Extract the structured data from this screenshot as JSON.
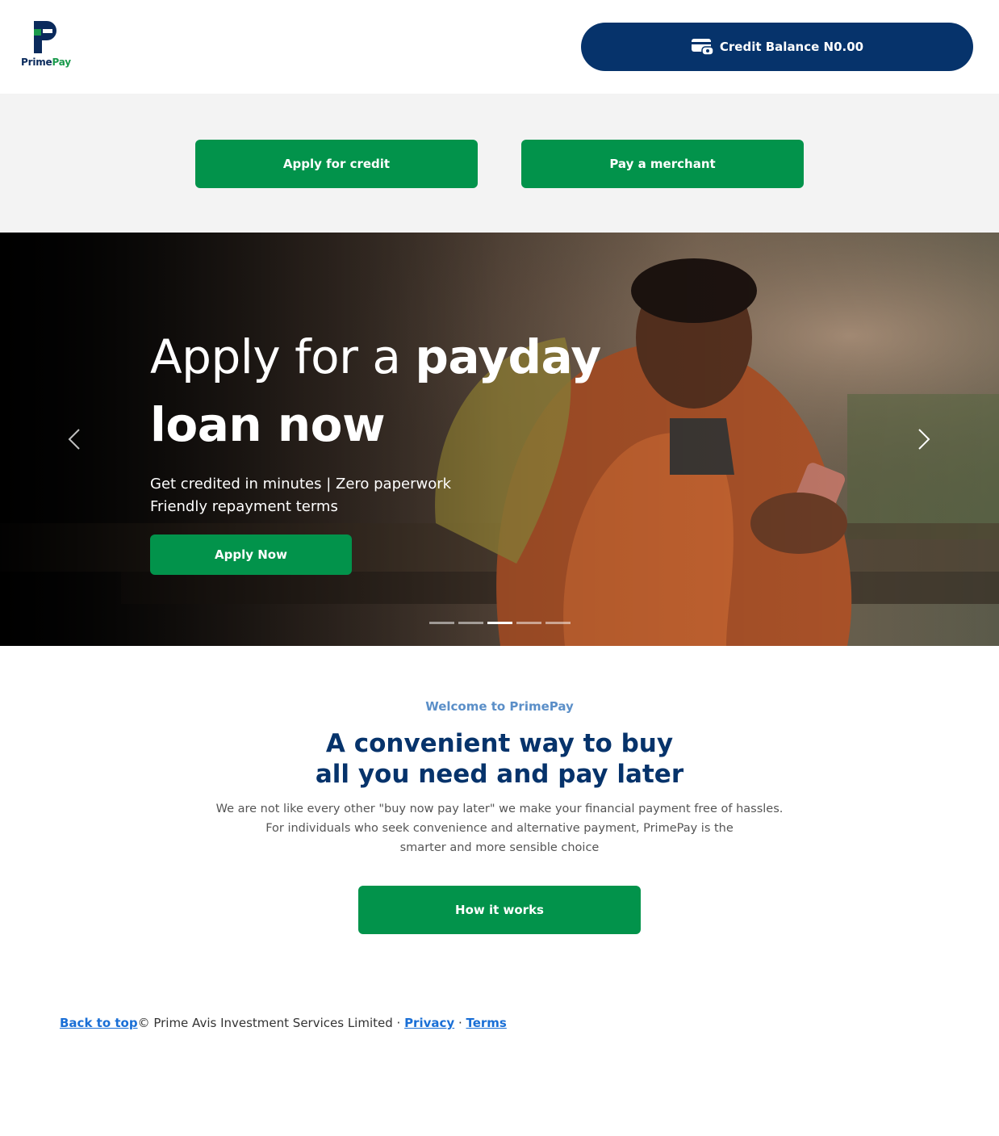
{
  "header": {
    "logo": {
      "prime": "Prime",
      "pay": "Pay"
    },
    "credit_balance_label": "Credit Balance N0.00"
  },
  "actions": {
    "apply_credit_label": "Apply for credit",
    "pay_merchant_label": "Pay a merchant"
  },
  "hero": {
    "title_light": "Apply for a ",
    "title_bold_1": "payday",
    "title_bold_2": "loan now",
    "subtitle_line1": "Get credited in minutes | Zero paperwork",
    "subtitle_line2": "Friendly repayment terms",
    "cta_label": "Apply Now",
    "slides": {
      "count": 5,
      "active_index": 2
    }
  },
  "welcome": {
    "kicker": "Welcome to PrimePay",
    "title_line1": "A convenient way to buy",
    "title_line2": "all you need and pay later",
    "body_line1": "We are not like every other \"buy now pay later\" we make your financial payment free of hassles.",
    "body_line2": "For individuals who seek convenience and alternative payment, PrimePay is the",
    "body_line3": "smarter and more sensible choice",
    "cta_label": "How it works"
  },
  "footer": {
    "back_to_top": "Back to top",
    "copyright": "© Prime Avis Investment Services Limited · ",
    "privacy": "Privacy",
    "separator": " · ",
    "terms": "Terms"
  },
  "colors": {
    "brand_navy": "#06336b",
    "brand_green": "#02934b",
    "kicker_blue": "#5b8fc8",
    "link_blue": "#1a6fd6"
  }
}
